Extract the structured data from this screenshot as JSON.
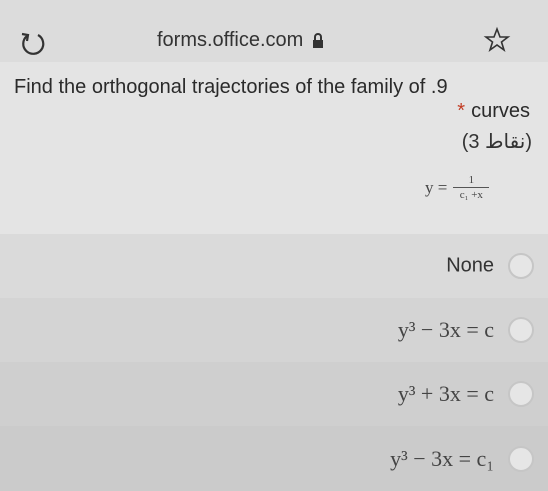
{
  "browser": {
    "url": "forms.office.com"
  },
  "question": {
    "line1": "Find the orthogonal trajectories of the family of .9",
    "required_mark": "*",
    "line2": "curves",
    "points": "(3 نقاط)",
    "equation": {
      "lhs": "y =",
      "numerator": "1",
      "denominator": "c₁ +x"
    }
  },
  "options": [
    {
      "label": "None",
      "selected": false
    },
    {
      "label": "y³ − 3x = c",
      "selected": false
    },
    {
      "label": "y³ + 3x = c",
      "selected": false
    },
    {
      "label": "y³ − 3x = c₁",
      "selected": false
    }
  ],
  "colors": {
    "required": "#c23b22",
    "background": "#d9d9d9"
  }
}
